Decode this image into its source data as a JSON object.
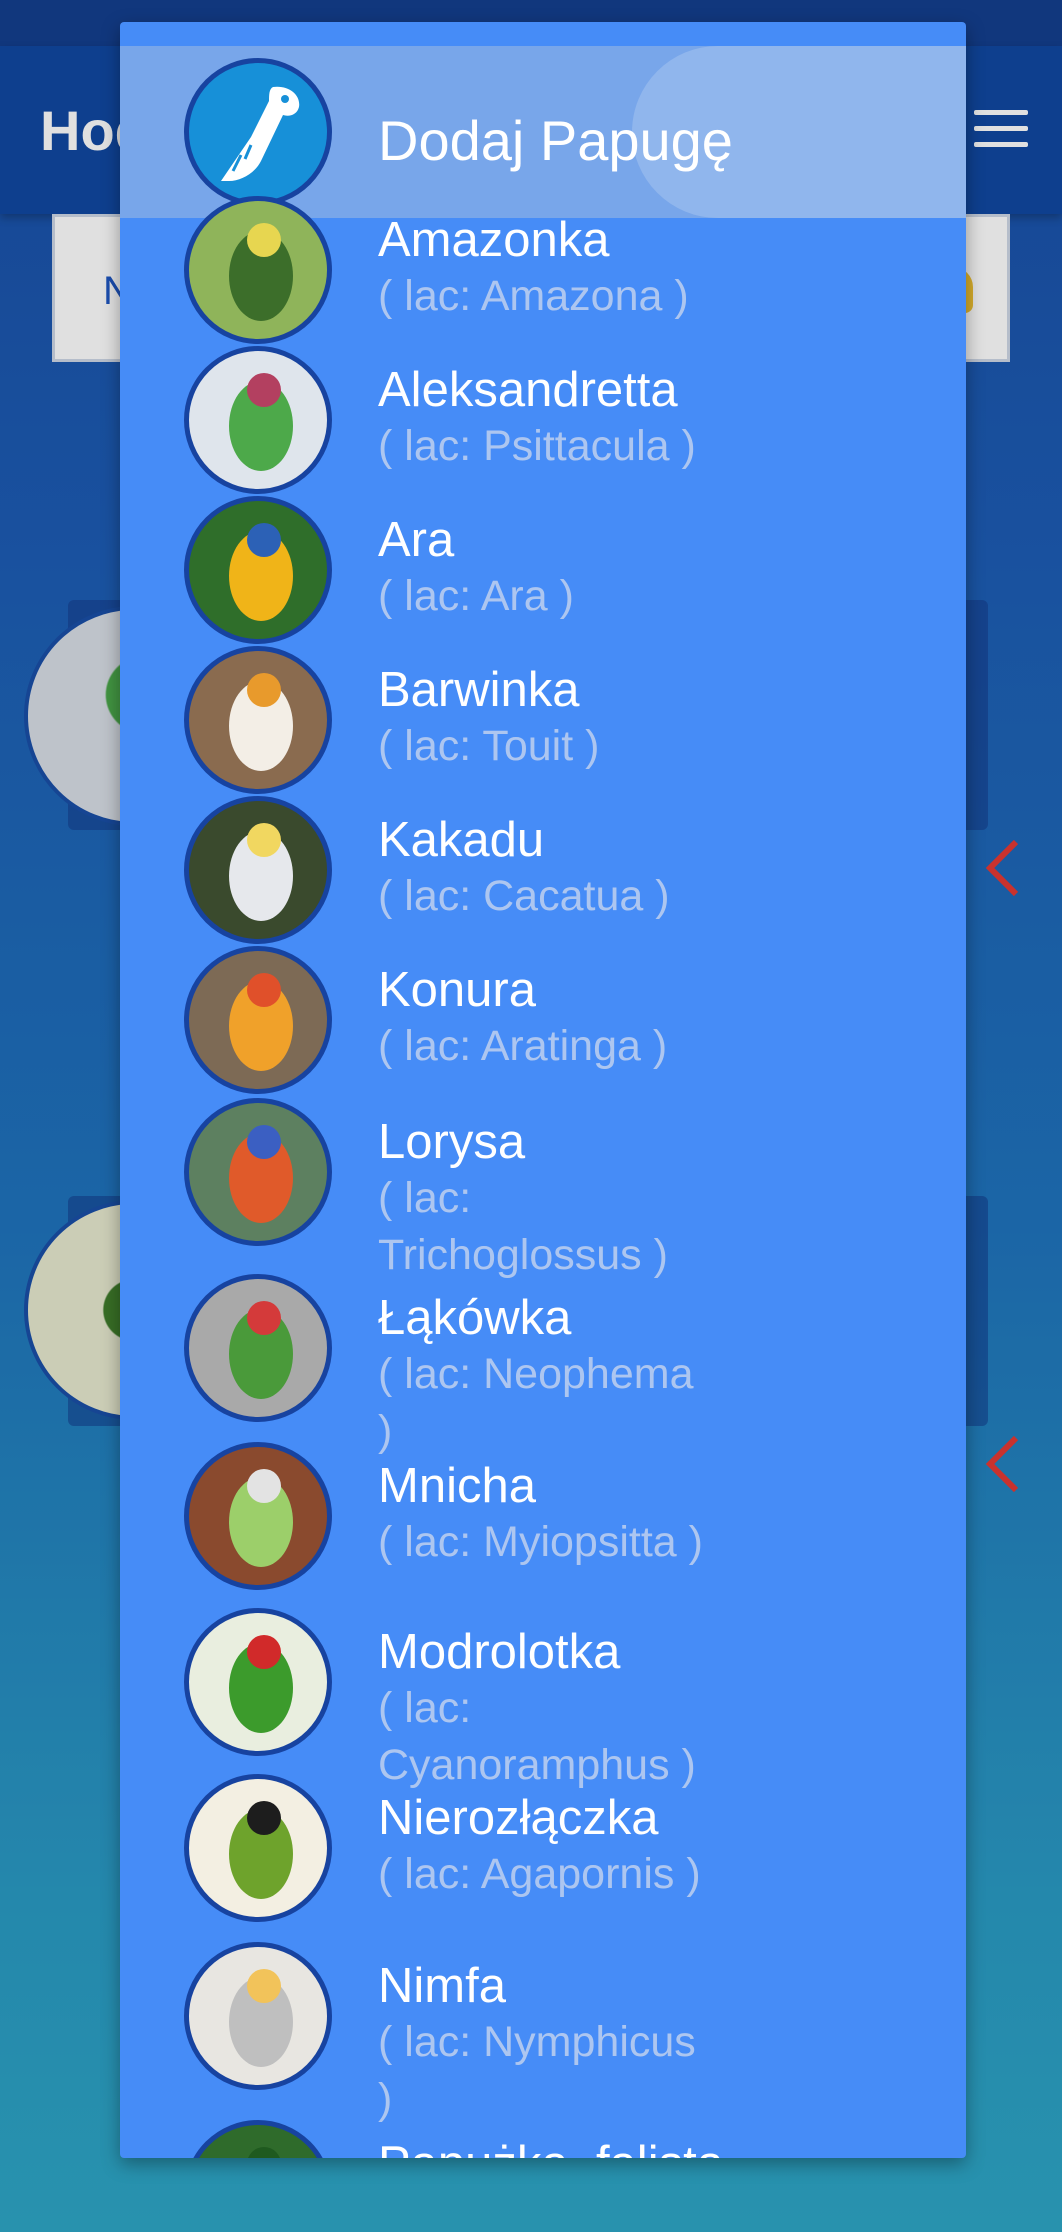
{
  "app": {
    "title": "Hodowla"
  },
  "search": {
    "hint": "N"
  },
  "menu": {
    "header_label": "Dodaj Papugę",
    "items": [
      {
        "name": "Amazonka",
        "latin": "( lac: Amazona )",
        "colors": [
          "#8fb45a",
          "#3c6e2a",
          "#e7d650"
        ]
      },
      {
        "name": "Aleksandretta",
        "latin": "( lac: Psittacula )",
        "colors": [
          "#dfe5ec",
          "#4da94a",
          "#b34060"
        ]
      },
      {
        "name": "Ara",
        "latin": "( lac: Ara )",
        "colors": [
          "#2f6e2a",
          "#f0b418",
          "#2c61b6"
        ]
      },
      {
        "name": "Barwinka",
        "latin": "( lac: Touit )",
        "colors": [
          "#8a6b4f",
          "#f3eee6",
          "#e89a2c"
        ]
      },
      {
        "name": "Kakadu",
        "latin": "( lac: Cacatua )",
        "colors": [
          "#3a4a2d",
          "#e6e8ec",
          "#f1d760"
        ]
      },
      {
        "name": "Konura",
        "latin": "( lac: Aratinga )",
        "colors": [
          "#7d6a55",
          "#f0a12a",
          "#e0502a"
        ]
      },
      {
        "name": "Lorysa",
        "latin": "( lac: Trichoglossus )",
        "colors": [
          "#5d8060",
          "#e05a2a",
          "#3b5fc2"
        ]
      },
      {
        "name": "Łąkówka",
        "latin": "( lac: Neophema )",
        "colors": [
          "#a9a9a9",
          "#4a9a3a",
          "#d43a3a"
        ]
      },
      {
        "name": "Mnicha",
        "latin": "( lac: Myiopsitta )",
        "colors": [
          "#8a4a2e",
          "#9ccf6a",
          "#e3e3e3"
        ]
      },
      {
        "name": "Modrolotka",
        "latin": "( lac: Cyanoramphus )",
        "colors": [
          "#e9eedf",
          "#3c9b2c",
          "#d12a2a"
        ]
      },
      {
        "name": "Nierozłączka",
        "latin": "( lac: Agapornis )",
        "colors": [
          "#f3efe2",
          "#6ea32c",
          "#1d1d1d"
        ]
      },
      {
        "name": "Nimfa",
        "latin": "( lac: Nymphicus )",
        "colors": [
          "#e8e6e1",
          "#bfbfbf",
          "#f2c35a"
        ]
      },
      {
        "name": "Papużka_falista",
        "latin": "",
        "colors": [
          "#2f6b2b",
          "#c8df45",
          "#1f5a1f"
        ]
      }
    ]
  }
}
